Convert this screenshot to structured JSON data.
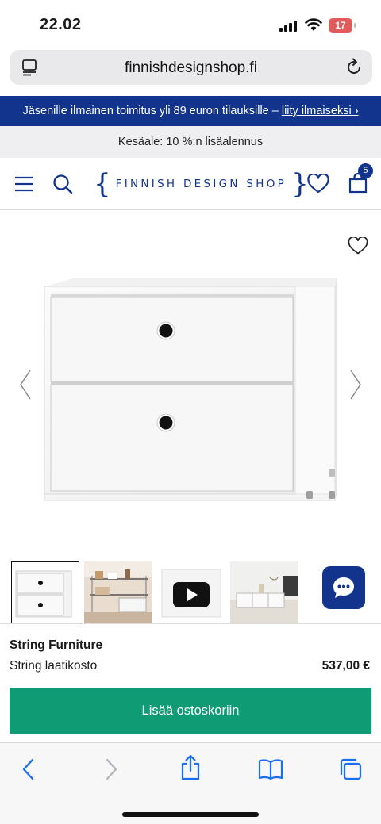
{
  "status_bar": {
    "time": "22.02",
    "battery": "17"
  },
  "url_bar": {
    "domain": "finnishdesignshop.fi"
  },
  "banner_blue": {
    "text": "Jäsenille ilmainen toimitus yli 89 euron tilauksille – ",
    "link": "liity ilmaiseksi ›"
  },
  "banner_grey": {
    "text": "Kesäale: 10 %:n lisäalennus"
  },
  "header": {
    "logo": {
      "left": "{",
      "word": "FINNISH DESIGN SHOP",
      "right": "}"
    },
    "cart_count": "5"
  },
  "product": {
    "brand": "String Furniture",
    "name": "String laatikosto",
    "price": "537,00 €",
    "add_to_cart_label": "Lisää ostoskoriin"
  },
  "colors": {
    "brand_blue": "#12348c",
    "cta_green": "#0f9c75",
    "ios_blue": "#1a6ef5"
  }
}
